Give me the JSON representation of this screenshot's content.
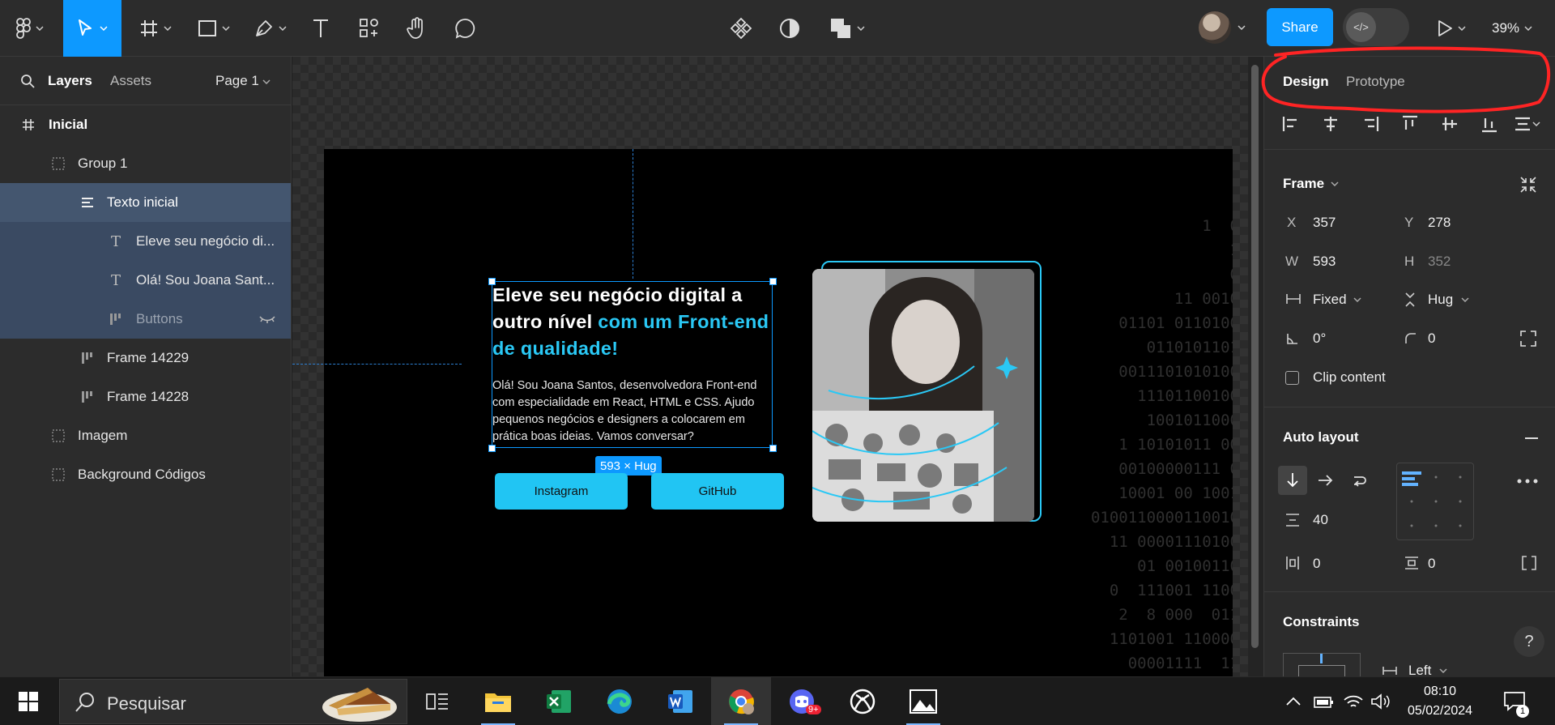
{
  "toolbar": {
    "share_label": "Share",
    "zoom_label": "39%",
    "dev_mode_label": "</>"
  },
  "left_panel": {
    "tabs": [
      "Layers",
      "Assets"
    ],
    "page_label": "Page 1",
    "layers": [
      {
        "label": "Inicial",
        "icon": "frame-hash-icon"
      },
      {
        "label": "Group 1",
        "icon": "group-icon"
      },
      {
        "label": "Texto inicial",
        "icon": "text-stack-icon"
      },
      {
        "label": "Eleve seu negócio di...",
        "icon": "text-icon"
      },
      {
        "label": "Olá! Sou Joana Sant...",
        "icon": "text-icon"
      },
      {
        "label": "Buttons",
        "icon": "autolayout-icon"
      },
      {
        "label": "Frame 14229",
        "icon": "autolayout-icon"
      },
      {
        "label": "Frame 14228",
        "icon": "autolayout-icon"
      },
      {
        "label": "Imagem",
        "icon": "group-icon"
      },
      {
        "label": "Background Códigos",
        "icon": "group-icon"
      }
    ]
  },
  "canvas": {
    "headline_part1": "Eleve seu negócio digital a outro nível ",
    "headline_part2": "com um Front-end de qualidade!",
    "paragraph": "Olá! Sou Joana Santos, desenvolvedora Front-end com especialidade em React, HTML e CSS. Ajudo pequenos negócios e designers a colocarem em prática boas ideias. Vamos conversar?",
    "size_badge": "593 × Hug",
    "button_instagram": "Instagram",
    "button_github": "GitHub",
    "code_text": "1  0\n1\n0\n11 0010\n01101 0110100\n0110101101\n0011101010100\n11101100100\n1001011000\n1 10101011 00\n00100000111 0\n10001 00 1001\n0100110000110010\n11 00001110100\n01 00100110\n0  111001 1100\n2  8 000  011\n1101001 110000\n00001111  11"
  },
  "right_panel": {
    "tabs": [
      "Design",
      "Prototype"
    ],
    "frame_label": "Frame",
    "x_label": "X",
    "x_value": "357",
    "y_label": "Y",
    "y_value": "278",
    "w_label": "W",
    "w_value": "593",
    "h_label": "H",
    "h_value": "352",
    "width_mode": "Fixed",
    "height_mode": "Hug",
    "rotation": "0°",
    "radius": "0",
    "clip_label": "Clip content",
    "auto_layout_label": "Auto layout",
    "gap_value": "40",
    "pad_h_value": "0",
    "pad_v_value": "0",
    "constraints_label": "Constraints",
    "constraint_h": "Left",
    "help_label": "?"
  },
  "taskbar": {
    "search_placeholder": "Pesquisar",
    "time": "08:10",
    "date": "05/02/2024",
    "discord_badge": "9+",
    "notif_count": "1"
  }
}
